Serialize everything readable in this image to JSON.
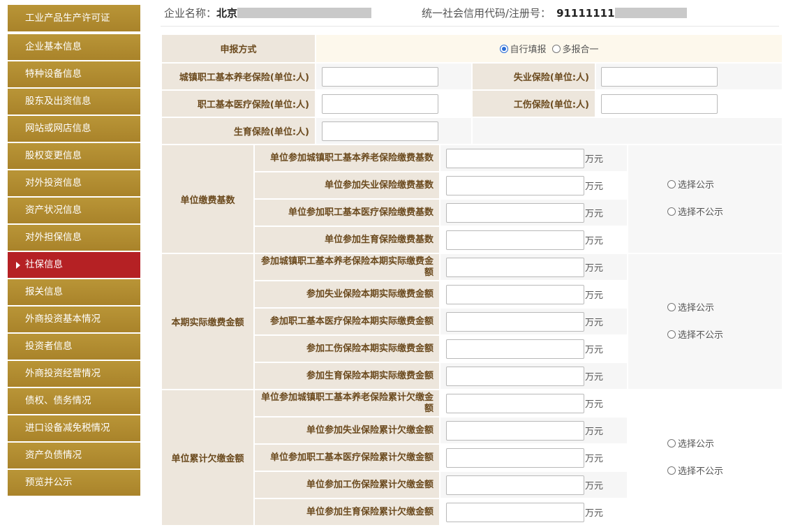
{
  "sidebar": {
    "items": [
      {
        "label": "工业产品生产许可证",
        "active": false
      },
      {
        "label": "企业基本信息",
        "active": false
      },
      {
        "label": "特种设备信息",
        "active": false
      },
      {
        "label": "股东及出资信息",
        "active": false
      },
      {
        "label": "网站或网店信息",
        "active": false
      },
      {
        "label": "股权变更信息",
        "active": false
      },
      {
        "label": "对外投资信息",
        "active": false
      },
      {
        "label": "资产状况信息",
        "active": false
      },
      {
        "label": "对外担保信息",
        "active": false
      },
      {
        "label": "社保信息",
        "active": true
      },
      {
        "label": "报关信息",
        "active": false
      },
      {
        "label": "外商投资基本情况",
        "active": false
      },
      {
        "label": "投资者信息",
        "active": false
      },
      {
        "label": "外商投资经营情况",
        "active": false
      },
      {
        "label": "债权、债务情况",
        "active": false
      },
      {
        "label": "进口设备减免税情况",
        "active": false
      },
      {
        "label": "资产负债情况",
        "active": false
      },
      {
        "label": "预览并公示",
        "active": false
      }
    ]
  },
  "header": {
    "company_label": "企业名称：",
    "company_value": "北京",
    "credit_label": "统一社会信用代码/注册号：",
    "credit_value": "91111111"
  },
  "form": {
    "report_method": {
      "label": "申报方式",
      "options": [
        "自行填报",
        "多报合一"
      ],
      "selected": "自行填报"
    },
    "insured": {
      "pension_label": "城镇职工基本养老保险(单位:人)",
      "unemployment_label": "失业保险(单位:人)",
      "medical_label": "职工基本医疗保险(单位:人)",
      "injury_label": "工伤保险(单位:人)",
      "maternity_label": "生育保险(单位:人)",
      "pension_value": "",
      "unemployment_value": "",
      "medical_value": "",
      "injury_value": "",
      "maternity_value": ""
    },
    "unit": "万元",
    "publish_option": "选择公示",
    "no_publish_option": "选择不公示",
    "groups": [
      {
        "title": "单位缴费基数",
        "rows": [
          {
            "label": "单位参加城镇职工基本养老保险缴费基数",
            "value": ""
          },
          {
            "label": "单位参加失业保险缴费基数",
            "value": ""
          },
          {
            "label": "单位参加职工基本医疗保险缴费基数",
            "value": ""
          },
          {
            "label": "单位参加生育保险缴费基数",
            "value": ""
          }
        ]
      },
      {
        "title": "本期实际缴费金额",
        "rows": [
          {
            "label": "参加城镇职工基本养老保险本期实际缴费金额",
            "value": ""
          },
          {
            "label": "参加失业保险本期实际缴费金额",
            "value": ""
          },
          {
            "label": "参加职工基本医疗保险本期实际缴费金额",
            "value": ""
          },
          {
            "label": "参加工伤保险本期实际缴费金额",
            "value": ""
          },
          {
            "label": "参加生育保险本期实际缴费金额",
            "value": ""
          }
        ]
      },
      {
        "title": "单位累计欠缴金额",
        "rows": [
          {
            "label": "单位参加城镇职工基本养老保险累计欠缴金额",
            "value": ""
          },
          {
            "label": "单位参加失业保险累计欠缴金额",
            "value": ""
          },
          {
            "label": "单位参加职工基本医疗保险累计欠缴金额",
            "value": ""
          },
          {
            "label": "单位参加工伤保险累计欠缴金额",
            "value": ""
          },
          {
            "label": "单位参加生育保险累计欠缴金额",
            "value": ""
          }
        ]
      }
    ]
  }
}
